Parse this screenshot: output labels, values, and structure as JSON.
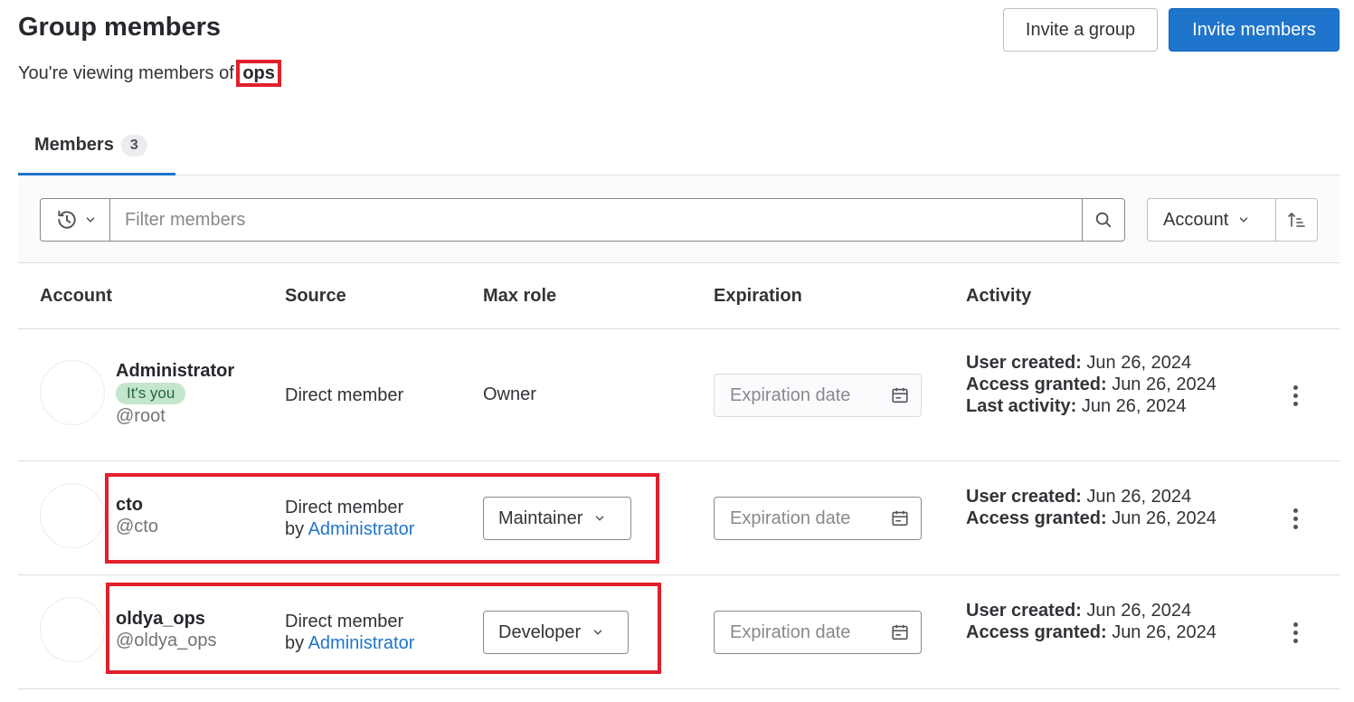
{
  "header": {
    "title": "Group members",
    "subtitle_prefix": "You're viewing members of ",
    "group_name": "ops",
    "subtitle_suffix": ".",
    "invite_group_label": "Invite a group",
    "invite_members_label": "Invite members"
  },
  "tabs": [
    {
      "label": "Members",
      "count": "3"
    }
  ],
  "filter": {
    "history_icon": "history-icon",
    "placeholder": "Filter members",
    "search_icon": "search-icon",
    "sort_label": "Account",
    "sort_direction_icon": "sort-ascending-icon"
  },
  "table": {
    "columns": [
      "Account",
      "Source",
      "Max role",
      "Expiration",
      "Activity"
    ],
    "rows": [
      {
        "name": "Administrator",
        "badge": "It's you",
        "username": "@root",
        "source_line1": "Direct member",
        "source_by": "",
        "source_link": "",
        "role": "Owner",
        "expiration_placeholder": "Expiration date",
        "user_created_label": "User created:",
        "user_created": "Jun 26, 2024",
        "access_granted_label": "Access granted:",
        "access_granted": "Jun 26, 2024",
        "last_activity_label": "Last activity:",
        "last_activity": "Jun 26, 2024"
      },
      {
        "name": "cto",
        "username": "@cto",
        "source_line1": "Direct member",
        "source_by": "by ",
        "source_link": "Administrator",
        "role": "Maintainer",
        "expiration_placeholder": "Expiration date",
        "user_created_label": "User created:",
        "user_created": "Jun 26, 2024",
        "access_granted_label": "Access granted:",
        "access_granted": "Jun 26, 2024"
      },
      {
        "name": "oldya_ops",
        "username": "@oldya_ops",
        "source_line1": "Direct member",
        "source_by": "by ",
        "source_link": "Administrator",
        "role": "Developer",
        "expiration_placeholder": "Expiration date",
        "user_created_label": "User created:",
        "user_created": "Jun 26, 2024",
        "access_granted_label": "Access granted:",
        "access_granted": "Jun 26, 2024"
      }
    ]
  },
  "colors": {
    "primary": "#1f75cb",
    "annotation": "#e1202c",
    "badge_bg": "#c3e6cd",
    "badge_text": "#24663b"
  }
}
